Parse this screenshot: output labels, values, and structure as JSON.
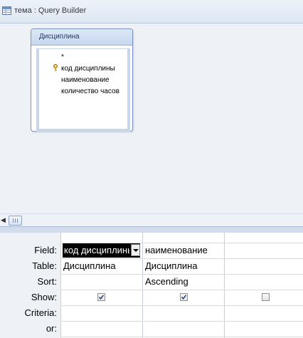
{
  "window": {
    "title": "тема : Query Builder"
  },
  "table_box": {
    "name": "Дисциплина",
    "fields": [
      "*",
      "код дисциплины",
      "наименование",
      "количество часов"
    ]
  },
  "grid": {
    "row_labels": [
      "Field:",
      "Table:",
      "Sort:",
      "Show:",
      "Criteria:",
      "or:"
    ],
    "columns": [
      {
        "field": "код дисциплины",
        "table": "Дисциплина",
        "sort": "",
        "show": true
      },
      {
        "field": "наименование",
        "table": "Дисциплина",
        "sort": "Ascending",
        "show": true
      },
      {
        "field": "",
        "table": "",
        "sort": "",
        "show": false
      }
    ]
  }
}
